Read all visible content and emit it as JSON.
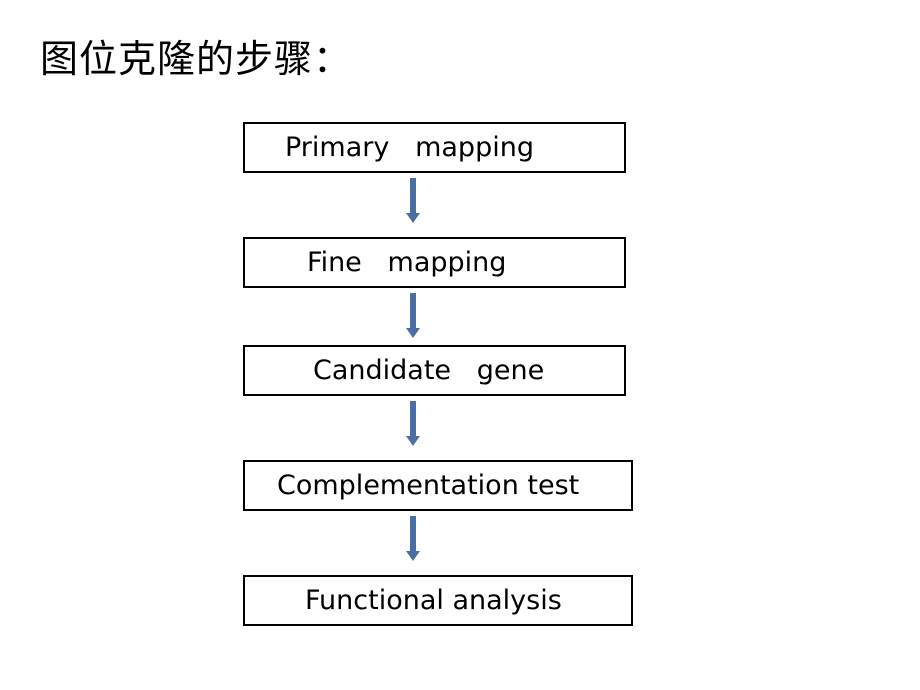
{
  "title": "图位克隆的步骤：",
  "steps": [
    {
      "label": "Primary   mapping"
    },
    {
      "label": "Fine   mapping"
    },
    {
      "label": "Candidate   gene"
    },
    {
      "label": "Complementation test"
    },
    {
      "label": "Functional analysis"
    }
  ],
  "colors": {
    "arrow": "#4a6fa5",
    "box_border": "#000000"
  }
}
